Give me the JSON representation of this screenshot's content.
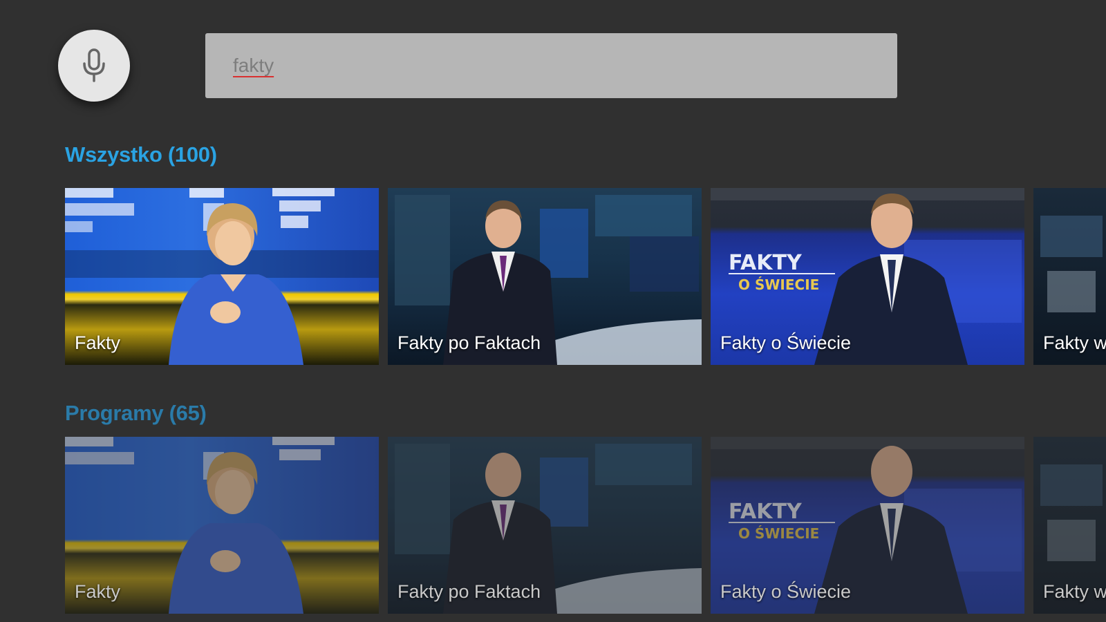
{
  "search": {
    "query": "fakty",
    "mic_icon": "microphone-icon"
  },
  "rows": [
    {
      "title": "Wszystko (100)",
      "cards": [
        {
          "title": "Fakty"
        },
        {
          "title": "Fakty po Faktach"
        },
        {
          "title": "Fakty o Świecie"
        },
        {
          "title": "Fakty w..."
        }
      ]
    },
    {
      "title": "Programy (65)",
      "cards": [
        {
          "title": "Fakty"
        },
        {
          "title": "Fakty po Faktach"
        },
        {
          "title": "Fakty o Świecie"
        },
        {
          "title": "Fakty w..."
        }
      ]
    }
  ],
  "thumbnail_text": {
    "fakty_logo": "FAKTY",
    "fakty_logo_sub": "O ŚWIECIE"
  },
  "colors": {
    "background": "#303030",
    "accent": "#2aa3e3",
    "search_field": "#b6b6b6"
  }
}
